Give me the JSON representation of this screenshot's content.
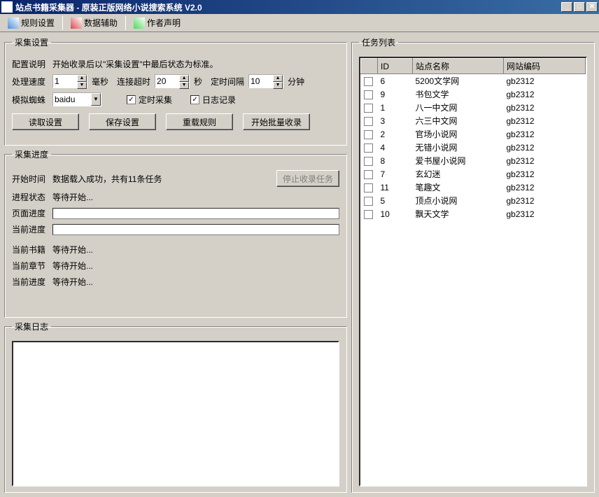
{
  "titlebar": {
    "title": "站点书籍采集器 - 原装正版网络小说搜索系统 V2.0"
  },
  "toolbar": {
    "rule_settings": "规则设置",
    "data_assist": "数据辅助",
    "author_note": "作者声明"
  },
  "settings": {
    "legend": "采集设置",
    "config_label": "配置说明",
    "config_text": "开始收录后以\"采集设置\"中最后状态为标准。",
    "speed_label": "处理速度",
    "speed_value": "1",
    "speed_unit": "毫秒",
    "timeout_label": "连接超时",
    "timeout_value": "20",
    "timeout_unit": "秒",
    "interval_label": "定时间隔",
    "interval_value": "10",
    "interval_unit": "分钟",
    "spider_label": "模拟蜘蛛",
    "spider_value": "baidu",
    "timed_collect": "定时采集",
    "log_record": "日志记录",
    "btn_read": "读取设置",
    "btn_save": "保存设置",
    "btn_reload": "重载规则",
    "btn_start": "开始批量收录"
  },
  "progress": {
    "legend": "采集进度",
    "start_time_label": "开始时间",
    "start_time_text": "数据载入成功，共有11条任务",
    "btn_stop": "停止收录任务",
    "status_label": "进程状态",
    "status_text": "等待开始...",
    "page_label": "页面进度",
    "current_label": "当前进度",
    "book_label": "当前书籍",
    "book_text": "等待开始...",
    "chapter_label": "当前章节",
    "chapter_text": "等待开始...",
    "curprog_label": "当前进度",
    "curprog_text": "等待开始..."
  },
  "log": {
    "legend": "采集日志"
  },
  "tasks": {
    "legend": "任务列表",
    "col_id": "ID",
    "col_name": "站点名称",
    "col_encoding": "网站编码",
    "rows": [
      {
        "id": "6",
        "name": "5200文学网",
        "encoding": "gb2312"
      },
      {
        "id": "9",
        "name": "书包文学",
        "encoding": "gb2312"
      },
      {
        "id": "1",
        "name": "八一中文网",
        "encoding": "gb2312"
      },
      {
        "id": "3",
        "name": "六三中文网",
        "encoding": "gb2312"
      },
      {
        "id": "2",
        "name": "官场小说网",
        "encoding": "gb2312"
      },
      {
        "id": "4",
        "name": "无错小说网",
        "encoding": "gb2312"
      },
      {
        "id": "8",
        "name": "爱书屋小说网",
        "encoding": "gb2312"
      },
      {
        "id": "7",
        "name": "玄幻迷",
        "encoding": "gb2312"
      },
      {
        "id": "11",
        "name": "笔趣文",
        "encoding": "gb2312"
      },
      {
        "id": "5",
        "name": "顶点小说网",
        "encoding": "gb2312"
      },
      {
        "id": "10",
        "name": "飘天文学",
        "encoding": "gb2312"
      }
    ]
  }
}
